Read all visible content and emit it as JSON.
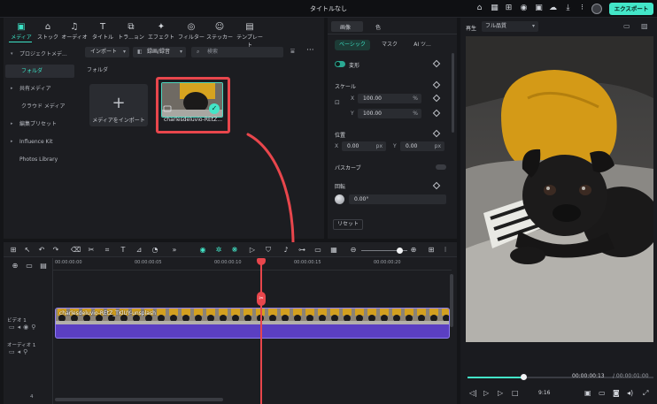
{
  "window": {
    "title": "タイトルなし",
    "export_label": "エクスポート"
  },
  "toolbar_tabs": [
    {
      "label": "メディア",
      "icon": "media-icon"
    },
    {
      "label": "ストック",
      "icon": "stock-icon"
    },
    {
      "label": "オーディオ",
      "icon": "audio-icon"
    },
    {
      "label": "タイトル",
      "icon": "title-icon"
    },
    {
      "label": "トラ...ョン",
      "icon": "transition-icon"
    },
    {
      "label": "エフェクト",
      "icon": "effect-icon"
    },
    {
      "label": "フィルター",
      "icon": "filter-icon"
    },
    {
      "label": "ステッカー",
      "icon": "sticker-icon"
    },
    {
      "label": "テンプレート",
      "icon": "template-icon"
    }
  ],
  "sidebar": {
    "items": [
      {
        "label": "プロジェクトメデ...",
        "arrow": "▾"
      },
      {
        "label": "フォルダ",
        "arrow": ""
      },
      {
        "label": "共有メディア",
        "arrow": "▸"
      },
      {
        "label": "クラウド メディア",
        "arrow": ""
      },
      {
        "label": "編集プリセット",
        "arrow": "▸"
      },
      {
        "label": "Influence Kit",
        "arrow": "▸"
      },
      {
        "label": "Photos Library",
        "arrow": ""
      }
    ]
  },
  "media": {
    "import_dropdown": "インポート",
    "filter_dropdown": "録画/録音",
    "search_placeholder": "検索",
    "folder_label": "フォルダ",
    "import_tile_label": "メディアをインポート",
    "clip_name": "charlesdeluvio-REtZ..."
  },
  "properties": {
    "tabs": [
      "画像",
      "色"
    ],
    "chips": [
      "ベーシック",
      "マスク",
      "AI ツ..."
    ],
    "transform_label": "変形",
    "scale_label": "スケール",
    "scale_x": "100.00",
    "scale_y": "100.00",
    "scale_unit": "%",
    "position_label": "位置",
    "pos_x": "0.00",
    "pos_y": "0.00",
    "pos_unit": "px",
    "bezier_label": "パスカーブ",
    "rotate_label": "回転",
    "rotate_value": "0.00°",
    "reset_label": "リセット",
    "x_axis": "X",
    "y_axis": "Y"
  },
  "player": {
    "label": "再生",
    "quality": "フル品質",
    "current_time": "00:00:00:13",
    "total_time": "/ 00:00:01:00",
    "progress": 0.3,
    "aspect": "9:16"
  },
  "timeline": {
    "ruler_ticks": [
      "00:00:00:00",
      "00:00:00:05",
      "00:00:00:10",
      "00:00:00:15",
      "00:00:00:20"
    ],
    "video_track_label": "ビデオ 1",
    "audio_track_label": "オーディオ 1",
    "clip_label": "charlesdeluvio-REtZ_TKlUY-unsplash",
    "track_number": "4"
  },
  "colors": {
    "accent": "#43e6c8",
    "annotation": "#e8464c",
    "audio_clip": "#6b4fd8"
  }
}
